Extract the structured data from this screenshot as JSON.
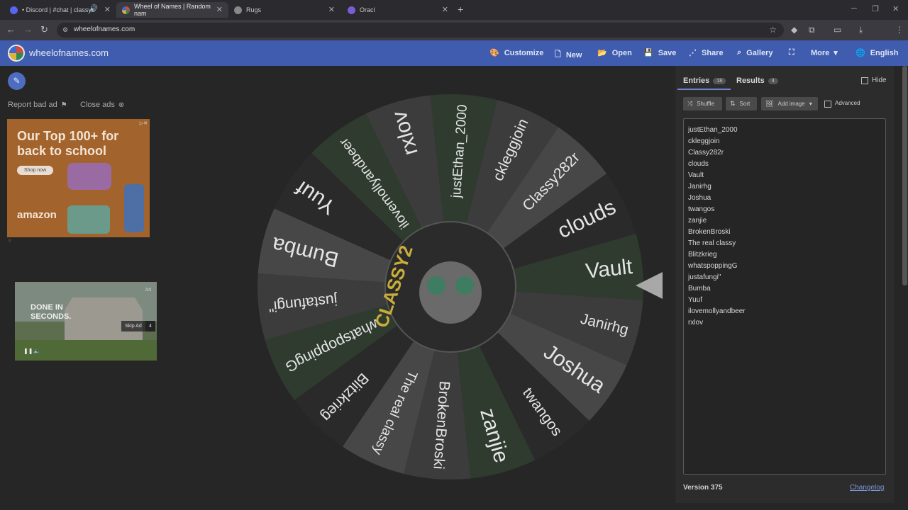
{
  "browser": {
    "tabs": [
      {
        "label": "• Discord | #chat | classy2",
        "color": "#5865f2"
      },
      {
        "label": "Wheel of Names | Random nam",
        "color": "#d14a3a"
      },
      {
        "label": "Rugs",
        "color": "#888888"
      },
      {
        "label": "Oracl",
        "color": "#7b5cd6"
      }
    ],
    "new_tab": "+",
    "url": "wheelofnames.com"
  },
  "app": {
    "site_name": "wheelofnames.com",
    "menu": {
      "customize": "Customize",
      "new": "New",
      "open": "Open",
      "save": "Save",
      "share": "Share",
      "gallery": "Gallery",
      "more": "More",
      "language": "English"
    }
  },
  "ads": {
    "report": "Report bad ad",
    "close": "Close ads",
    "ad1": {
      "line1": "Our Top 100+ for",
      "line2": "back to school",
      "shop": "Shop now",
      "brand": "amazon"
    },
    "ad2": {
      "line1": "DONE IN",
      "line2": "SECONDS.",
      "ad_label": "Ad",
      "skip": "Skip Ad",
      "skip_count": "4"
    }
  },
  "wheel": {
    "center_text": "CLASSY2",
    "names": [
      "justEthan_2000",
      "ckleggjoin",
      "Classy282r",
      "clouds",
      "Vault",
      "Janirhg",
      "Joshua",
      "twangos",
      "zanjie",
      "BrokenBroski",
      "The real classy",
      "Blitzkrieg",
      "whatspoppingG",
      "justafungi\"",
      "Bumba",
      "Yuuf",
      "ilovemollyandbeer",
      "rxlov"
    ],
    "colors": [
      "#2f3b2f",
      "#3c3c3c",
      "#474747",
      "#2a2a2a"
    ]
  },
  "panel": {
    "tab_entries": "Entries",
    "entries_count": "18",
    "tab_results": "Results",
    "results_count": "4",
    "hide": "Hide",
    "shuffle": "Shuffle",
    "sort": "Sort",
    "add_image": "Add image",
    "advanced": "Advanced",
    "entries": [
      "justEthan_2000",
      "ckleggjoin",
      "Classy282r",
      "clouds",
      "Vault",
      "Janirhg",
      "Joshua",
      "twangos",
      "zanjie",
      "BrokenBroski",
      "The real classy",
      "Blitzkrieg",
      "whatspoppingG",
      "justafungi\"",
      "Bumba",
      "Yuuf",
      "ilovemollyandbeer",
      "rxlov"
    ],
    "version": "Version 375",
    "changelog": "Changelog"
  }
}
